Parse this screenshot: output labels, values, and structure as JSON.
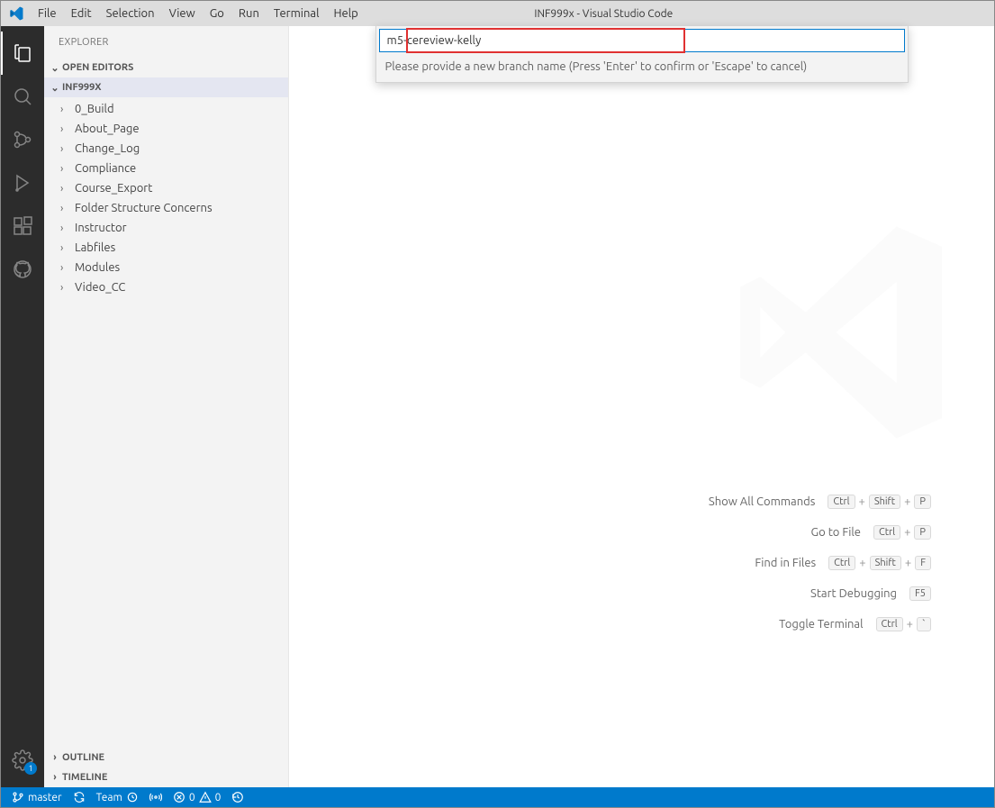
{
  "title": "INF999x - Visual Studio Code",
  "menu": [
    "File",
    "Edit",
    "Selection",
    "View",
    "Go",
    "Run",
    "Terminal",
    "Help"
  ],
  "explorer": {
    "header": "EXPLORER",
    "openEditors": "OPEN EDITORS",
    "project": "INF999X",
    "items": [
      "0_Build",
      "About_Page",
      "Change_Log",
      "Compliance",
      "Course_Export",
      "Folder Structure Concerns",
      "Instructor",
      "Labfiles",
      "Modules",
      "Video_CC"
    ],
    "outline": "OUTLINE",
    "timeline": "TIMELINE"
  },
  "quickinput": {
    "value": "m5-cereview-kelly",
    "desc": "Please provide a new branch name (Press 'Enter' to confirm or 'Escape' to cancel)"
  },
  "welcome": {
    "rows": [
      {
        "label": "Show All Commands",
        "keys": [
          "Ctrl",
          "+",
          "Shift",
          "+",
          "P"
        ]
      },
      {
        "label": "Go to File",
        "keys": [
          "Ctrl",
          "+",
          "P"
        ]
      },
      {
        "label": "Find in Files",
        "keys": [
          "Ctrl",
          "+",
          "Shift",
          "+",
          "F"
        ]
      },
      {
        "label": "Start Debugging",
        "keys": [
          "F5"
        ]
      },
      {
        "label": "Toggle Terminal",
        "keys": [
          "Ctrl",
          "+",
          "`"
        ]
      }
    ]
  },
  "status": {
    "branch": "master",
    "team": "Team",
    "errors": "0",
    "warnings": "0"
  },
  "activity_badge": "1"
}
